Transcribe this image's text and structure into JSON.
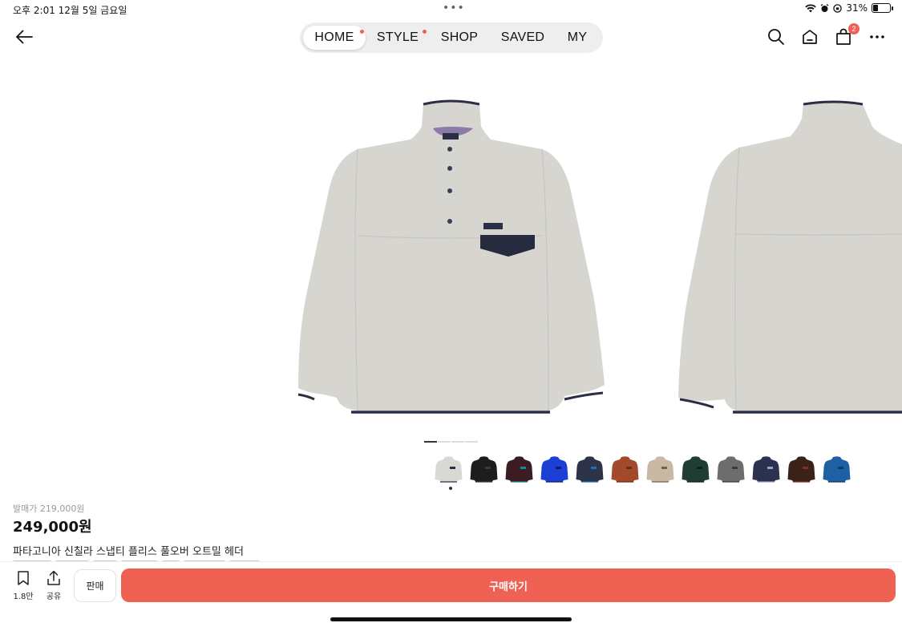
{
  "status_bar": {
    "time_date": "오후 2:01   12월 5일 금요일",
    "more_dots": "•••",
    "battery_text": "31%",
    "battery_level": 0.31
  },
  "nav": {
    "tabs": [
      {
        "label": "HOME",
        "active": true,
        "dot": true
      },
      {
        "label": "STYLE",
        "active": false,
        "dot": true
      },
      {
        "label": "SHOP",
        "active": false,
        "dot": false
      },
      {
        "label": "SAVED",
        "active": false,
        "dot": false
      },
      {
        "label": "MY",
        "active": false,
        "dot": false
      }
    ],
    "cart_badge": "2",
    "icons": [
      "back-arrow-icon",
      "search-icon",
      "home-icon",
      "shopping-bag-icon",
      "more-icon"
    ]
  },
  "gallery": {
    "image_count": 4,
    "current_index": 0
  },
  "swatches": [
    {
      "name": "oatmeal",
      "body": "#d9d8d3",
      "accent": "#2a2f45"
    },
    {
      "name": "black",
      "body": "#1d1d1f",
      "accent": "#3a3a3a"
    },
    {
      "name": "burgundy",
      "body": "#3a1c22",
      "accent": "#1a8a8a"
    },
    {
      "name": "royal-blue",
      "body": "#1c3fd6",
      "accent": "#0b1d6e"
    },
    {
      "name": "navy",
      "body": "#2d3349",
      "accent": "#1e6fbf"
    },
    {
      "name": "rust",
      "body": "#a34a2c",
      "accent": "#6b2a16"
    },
    {
      "name": "tan",
      "body": "#c9b8a4",
      "accent": "#7a5f4a"
    },
    {
      "name": "forest",
      "body": "#1f3d34",
      "accent": "#0e201a"
    },
    {
      "name": "grey",
      "body": "#6d6d6f",
      "accent": "#3a3a3a"
    },
    {
      "name": "navy-pattern",
      "body": "#2c3150",
      "accent": "#9aa0c0"
    },
    {
      "name": "brown",
      "body": "#3b2218",
      "accent": "#8a2a2a"
    },
    {
      "name": "lagoon-blue",
      "body": "#1f5fa3",
      "accent": "#0e3a6a"
    }
  ],
  "product": {
    "release_price": "발매가 219,000원",
    "price": "249,000원",
    "name": "파타고니아 신칠라 스냅티 플리스 풀오버 오트밀 헤더"
  },
  "bottom_bar": {
    "save_count": "1.8만",
    "share_label": "공유",
    "sell_label": "판매",
    "buy_label": "구매하기"
  },
  "colors": {
    "accent": "#ef6253",
    "fleece": "#d6d5d0",
    "trim": "#2a2f45"
  }
}
